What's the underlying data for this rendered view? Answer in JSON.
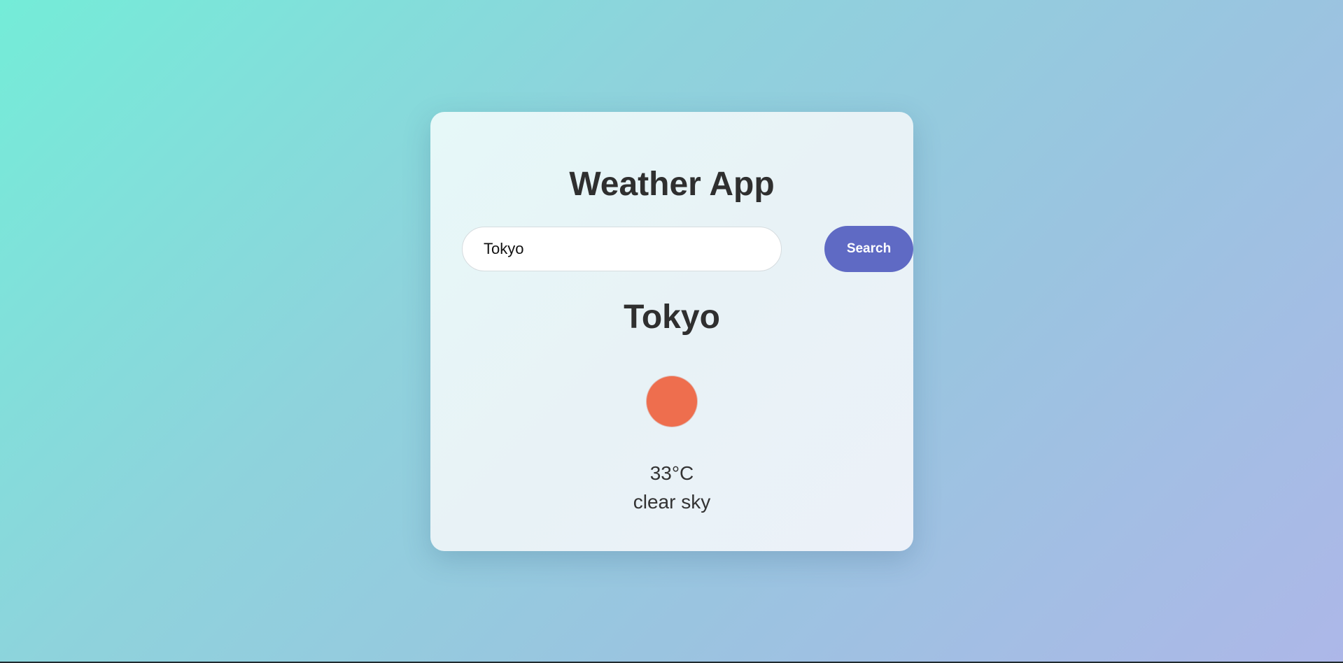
{
  "app": {
    "title": "Weather App"
  },
  "search": {
    "value": "Tokyo",
    "button_label": "Search"
  },
  "weather": {
    "city": "Tokyo",
    "icon": "sun-icon",
    "temperature": "33°C",
    "description": "clear sky"
  },
  "colors": {
    "accent": "#5f6ac4",
    "sun": "#ee6e4e",
    "text": "#2f2f2f"
  }
}
